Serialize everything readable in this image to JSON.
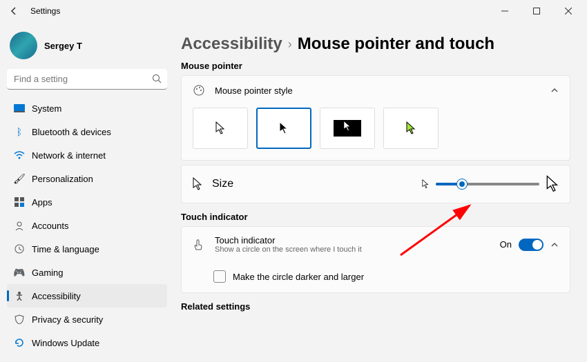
{
  "window": {
    "title": "Settings"
  },
  "profile": {
    "name": "Sergey T"
  },
  "search": {
    "placeholder": "Find a setting"
  },
  "nav": {
    "items": [
      {
        "label": "System"
      },
      {
        "label": "Bluetooth & devices"
      },
      {
        "label": "Network & internet"
      },
      {
        "label": "Personalization"
      },
      {
        "label": "Apps"
      },
      {
        "label": "Accounts"
      },
      {
        "label": "Time & language"
      },
      {
        "label": "Gaming"
      },
      {
        "label": "Accessibility"
      },
      {
        "label": "Privacy & security"
      },
      {
        "label": "Windows Update"
      }
    ]
  },
  "breadcrumb": {
    "parent": "Accessibility",
    "page": "Mouse pointer and touch"
  },
  "sections": {
    "mouse_pointer": "Mouse pointer",
    "touch_indicator": "Touch indicator",
    "related": "Related settings"
  },
  "cards": {
    "style_label": "Mouse pointer style",
    "size_label": "Size",
    "touch_title": "Touch indicator",
    "touch_sub": "Show a circle on the screen where I touch it",
    "touch_state": "On",
    "checkbox_label": "Make the circle darker and larger"
  },
  "slider": {
    "value_percent": 25
  }
}
